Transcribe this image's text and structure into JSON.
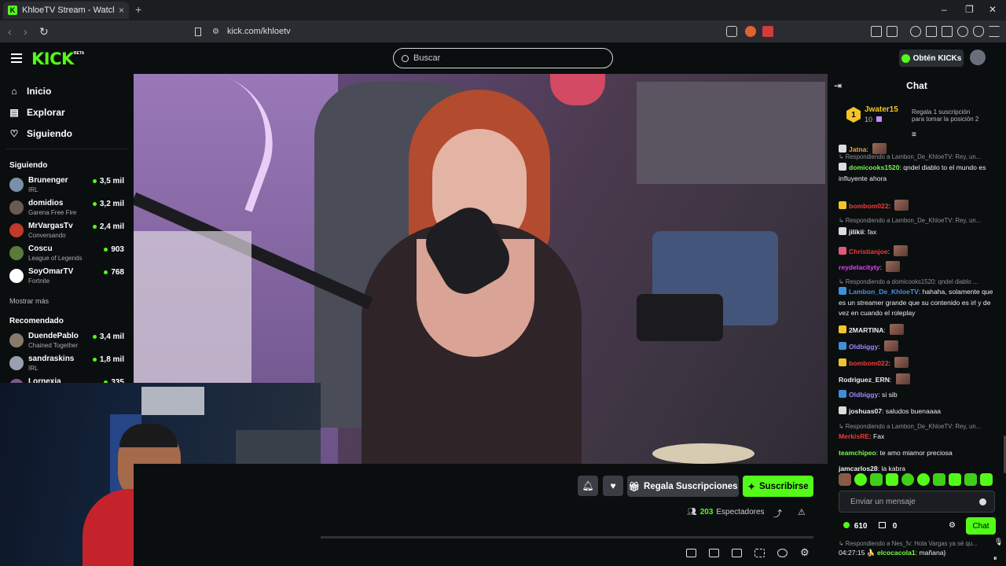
{
  "browser": {
    "tab_title": "KhloeTV Stream - Watch Live on Kick",
    "url": "kick.com/khloetv",
    "new_tab": "+",
    "tab_close": "×",
    "min": "–",
    "max": "❐",
    "close": "✕"
  },
  "header": {
    "logo": "KICK",
    "beta": "BETA",
    "search_placeholder": "Buscar",
    "kicks_button": "Obtén KICKs"
  },
  "sidebar": {
    "nav": [
      {
        "label": "Inicio",
        "icon": "home-icon"
      },
      {
        "label": "Explorar",
        "icon": "explore-icon"
      },
      {
        "label": "Siguiendo",
        "icon": "heart-icon"
      }
    ],
    "following_title": "Siguiendo",
    "following": [
      {
        "name": "Brunenger",
        "category": "IRL",
        "viewers": "3,5 mil",
        "color": "#7b8fa8"
      },
      {
        "name": "domidios",
        "category": "Garena Free Fire",
        "viewers": "3,2 mil",
        "color": "#6b5a50"
      },
      {
        "name": "MrVargasTv",
        "category": "Conversando",
        "viewers": "2,4 mil",
        "color": "#c0392b"
      },
      {
        "name": "Coscu",
        "category": "League of Legends",
        "viewers": "903",
        "color": "#5a7a3a"
      },
      {
        "name": "SoyOmarTV",
        "category": "Fortnite",
        "viewers": "768",
        "color": "#ffffff"
      }
    ],
    "show_more": "Mostrar más",
    "recommended_title": "Recomendado",
    "recommended": [
      {
        "name": "DuendePablo",
        "category": "Chained Together",
        "viewers": "3,4 mil",
        "color": "#8a7a6a"
      },
      {
        "name": "sandraskins",
        "category": "IRL",
        "viewers": "1,8 mil",
        "color": "#9aa0b0"
      },
      {
        "name": "Lornexia",
        "category": "",
        "viewers": "335",
        "color": "#7a5a8a"
      }
    ]
  },
  "player": {
    "gift_label": "Regala Suscripciones",
    "subscribe_label": "Suscribirse",
    "viewer_count": "203",
    "viewer_label": "Espectadores"
  },
  "chat": {
    "title": "Chat",
    "leader": {
      "rank": "1",
      "name": "Jwater15",
      "count": "10",
      "gift_line1": "Regala 1 suscripción",
      "gift_line2": "para tomar la posición 2"
    },
    "messages": [
      {
        "reply": "",
        "user": "Jatna",
        "color": "#f5a623",
        "text": "",
        "emote": true,
        "badge": "#dddddd"
      },
      {
        "reply": "Respondiendo a Lambon_De_KhloeTV: Rey, un...",
        "user": "domicooks1520",
        "color": "#75fd46",
        "text": "qndel diablo to el mundo es influyente ahora",
        "emote": false,
        "badge": "#dddddd"
      },
      {
        "reply": "",
        "user": "bombom022",
        "color": "#f23a3a",
        "text": "",
        "emote": true,
        "badge": "#f3c428"
      },
      {
        "reply": "Respondiendo a Lambon_De_KhloeTV: Rey, un...",
        "user": "jilikii",
        "color": "#efeff1",
        "text": "fax",
        "emote": false,
        "badge": "#dddddd"
      },
      {
        "reply": "",
        "user": "Christianjoe",
        "color": "#f23a3a",
        "text": "",
        "emote": true,
        "badge": "#e05a7a"
      },
      {
        "reply": "",
        "user": "reydelacityty",
        "color": "#e040fb",
        "text": "",
        "emote": true,
        "badge": ""
      },
      {
        "reply": "Respondiendo a domicooks1520: qndel diablo ...",
        "user": "Lambon_De_KhloeTV",
        "color": "#4a90e2",
        "text": "hahaha, solamente que es un streamer grande que su contenido es irl y de vez en cuando el roleplay",
        "emote": false,
        "badge": "#3d8fd9"
      },
      {
        "reply": "",
        "user": "2MARTINA",
        "color": "#efeff1",
        "text": "",
        "emote": true,
        "badge": "#f3c428"
      },
      {
        "reply": "",
        "user": "Oldbiggy",
        "color": "#9b8cff",
        "text": "",
        "emote": true,
        "badge": "#3d8fd9"
      },
      {
        "reply": "",
        "user": "bombom022",
        "color": "#f23a3a",
        "text": "",
        "emote": true,
        "badge": "#f3c428"
      },
      {
        "reply": "",
        "user": "Rodriguez_ERN",
        "color": "#efeff1",
        "text": "",
        "emote": true,
        "badge": ""
      },
      {
        "reply": "",
        "user": "Oldbiggy",
        "color": "#9b8cff",
        "text": "si sib",
        "emote": false,
        "badge": "#3d8fd9"
      },
      {
        "reply": "",
        "user": "joshuas07",
        "color": "#efeff1",
        "text": "saludos buenaaaa",
        "emote": false,
        "badge": "#dddddd"
      },
      {
        "reply": "Respondiendo a Lambon_De_KhloeTV: Rey, un...",
        "user": "MerkisRE",
        "color": "#f23a3a",
        "text": "Fax",
        "emote": false,
        "badge": ""
      },
      {
        "reply": "",
        "user": "teamchipeo",
        "color": "#75fd46",
        "text": "te amo miamor preciosa",
        "emote": false,
        "badge": ""
      },
      {
        "reply": "",
        "user": "jamcarlos28",
        "color": "#efeff1",
        "text": "la kabra",
        "emote": false,
        "badge": ""
      }
    ],
    "input_placeholder": "Enviar un mensaje",
    "points": "610",
    "coins": "0",
    "send_label": "Chat",
    "pinned_reply": "Respondiendo a Nes_fv: Hola Vargas ya sé qu...",
    "last_time": "04:27:15",
    "last_user": "elcocacola1",
    "last_text": "mañana}"
  }
}
